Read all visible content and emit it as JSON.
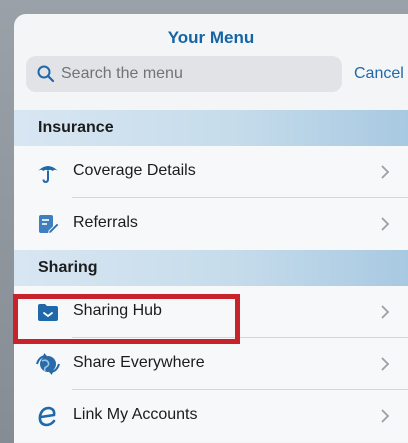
{
  "header": {
    "title": "Your Menu"
  },
  "search": {
    "placeholder": "Search the menu",
    "cancel_label": "Cancel"
  },
  "sections": [
    {
      "label": "Insurance",
      "items": [
        {
          "label": "Coverage Details",
          "icon": "umbrella-icon"
        },
        {
          "label": "Referrals",
          "icon": "referral-form-icon"
        }
      ]
    },
    {
      "label": "Sharing",
      "items": [
        {
          "label": "Sharing Hub",
          "icon": "folder-share-icon",
          "highlighted": true
        },
        {
          "label": "Share Everywhere",
          "icon": "globe-share-icon"
        },
        {
          "label": "Link My Accounts",
          "icon": "link-e-icon"
        }
      ]
    }
  ],
  "colors": {
    "accent": "#1565a6",
    "highlight": "#c8232c",
    "section_bg": "#c6dceb"
  }
}
